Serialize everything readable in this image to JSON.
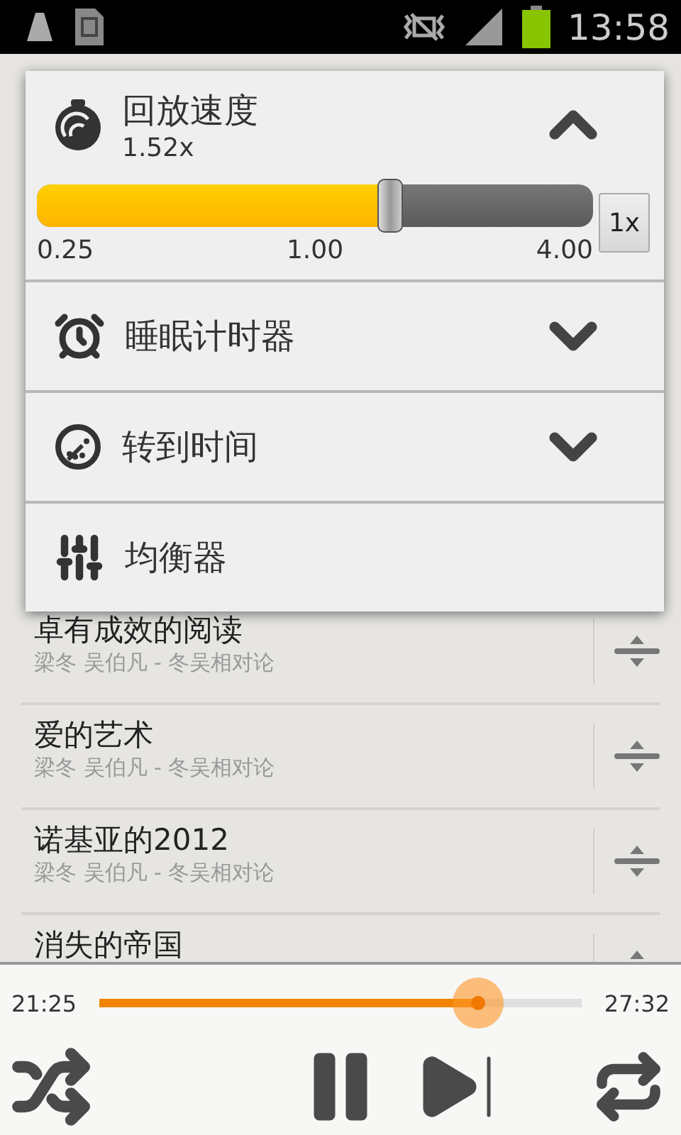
{
  "status_bar": {
    "time": "13:58"
  },
  "popup": {
    "sections": [
      {
        "kind": "speed",
        "title": "回放速度",
        "value": "1.52x",
        "expanded": true,
        "level": 0.635,
        "ticks": [
          "0.25",
          "1.00",
          "4.00"
        ],
        "reset": "1x"
      },
      {
        "kind": "expandable",
        "title": "睡眠计时器",
        "expanded": false
      },
      {
        "kind": "expandable",
        "title": "转到时间",
        "expanded": false
      },
      {
        "kind": "plain",
        "title": "均衡器"
      }
    ]
  },
  "tracks": [
    {
      "title": "卓有成效的阅读",
      "subtitle": "梁冬 吴伯凡 - 冬吴相对论"
    },
    {
      "title": "爱的艺术",
      "subtitle": "梁冬 吴伯凡 - 冬吴相对论"
    },
    {
      "title": "诺基亚的2012",
      "subtitle": "梁冬 吴伯凡 - 冬吴相对论"
    },
    {
      "title": "消失的帝国"
    }
  ],
  "player": {
    "elapsed": "21:25",
    "total": "27:32",
    "level": 0.785
  }
}
